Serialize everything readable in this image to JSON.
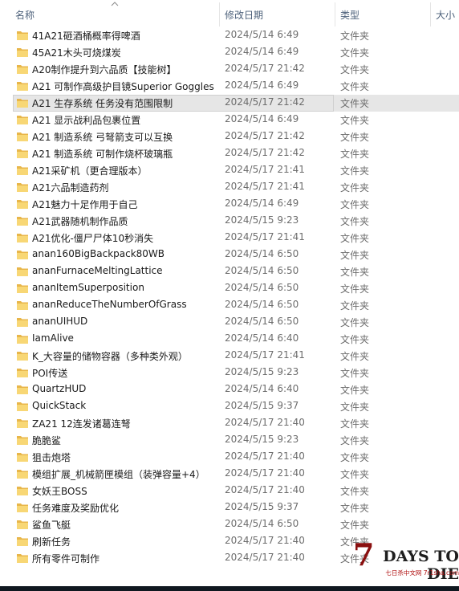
{
  "header": {
    "col_name": "名称",
    "col_date": "修改日期",
    "col_type": "类型",
    "col_size": "大小",
    "sort_icon": "chevron-up-icon"
  },
  "files": [
    {
      "name": "41A21砸酒桶概率得啤酒",
      "date": "2024/5/14 6:49",
      "type": "文件夹"
    },
    {
      "name": "45A21木头可烧煤炭",
      "date": "2024/5/14 6:49",
      "type": "文件夹"
    },
    {
      "name": "A20制作提升到六品质【技能树】",
      "date": "2024/5/17 21:42",
      "type": "文件夹"
    },
    {
      "name": "A21 可制作高级护目镜Superior Goggles",
      "date": "2024/5/14 6:49",
      "type": "文件夹"
    },
    {
      "name": "A21 生存系统 任务没有范围限制",
      "date": "2024/5/17 21:42",
      "type": "文件夹",
      "selected": true
    },
    {
      "name": "A21 显示战利品包裹位置",
      "date": "2024/5/14 6:49",
      "type": "文件夹"
    },
    {
      "name": "A21 制造系统 弓弩箭支可以互换",
      "date": "2024/5/17 21:42",
      "type": "文件夹"
    },
    {
      "name": "A21 制造系统 可制作烧杯玻璃瓶",
      "date": "2024/5/17 21:42",
      "type": "文件夹"
    },
    {
      "name": "A21采矿机（更合理版本）",
      "date": "2024/5/17 21:41",
      "type": "文件夹"
    },
    {
      "name": "A21六品制造药剂",
      "date": "2024/5/17 21:41",
      "type": "文件夹"
    },
    {
      "name": "A21魅力十足作用于自己",
      "date": "2024/5/14 6:49",
      "type": "文件夹"
    },
    {
      "name": "A21武器随机制作品质",
      "date": "2024/5/15 9:23",
      "type": "文件夹"
    },
    {
      "name": "A21优化-僵尸尸体10秒消失",
      "date": "2024/5/17 21:41",
      "type": "文件夹"
    },
    {
      "name": "anan160BigBackpack80WB",
      "date": "2024/5/14 6:50",
      "type": "文件夹"
    },
    {
      "name": "ananFurnaceMeltingLattice",
      "date": "2024/5/14 6:50",
      "type": "文件夹"
    },
    {
      "name": "ananItemSuperposition",
      "date": "2024/5/14 6:50",
      "type": "文件夹"
    },
    {
      "name": "ananReduceTheNumberOfGrass",
      "date": "2024/5/14 6:50",
      "type": "文件夹"
    },
    {
      "name": "ananUIHUD",
      "date": "2024/5/14 6:50",
      "type": "文件夹"
    },
    {
      "name": "IamAlive",
      "date": "2024/5/14 6:40",
      "type": "文件夹"
    },
    {
      "name": "K_大容量的储物容器（多种类外观）",
      "date": "2024/5/17 21:41",
      "type": "文件夹"
    },
    {
      "name": "POI传送",
      "date": "2024/5/15 9:23",
      "type": "文件夹"
    },
    {
      "name": "QuartzHUD",
      "date": "2024/5/14 6:40",
      "type": "文件夹"
    },
    {
      "name": "QuickStack",
      "date": "2024/5/15 9:37",
      "type": "文件夹"
    },
    {
      "name": "ZA21 12连发诸葛连弩",
      "date": "2024/5/17 21:40",
      "type": "文件夹"
    },
    {
      "name": "脆脆鲨",
      "date": "2024/5/15 9:23",
      "type": "文件夹"
    },
    {
      "name": "狙击炮塔",
      "date": "2024/5/17 21:40",
      "type": "文件夹"
    },
    {
      "name": "模组扩展_机械箭匣模组（装弹容量+4）",
      "date": "2024/5/17 21:40",
      "type": "文件夹"
    },
    {
      "name": "女妖王BOSS",
      "date": "2024/5/17 21:40",
      "type": "文件夹"
    },
    {
      "name": "任务难度及奖励优化",
      "date": "2024/5/15 9:37",
      "type": "文件夹"
    },
    {
      "name": "鲨鱼飞艇",
      "date": "2024/5/14 6:50",
      "type": "文件夹"
    },
    {
      "name": "刷新任务",
      "date": "2024/5/17 21:40",
      "type": "文件夹"
    },
    {
      "name": "所有零件可制作",
      "date": "2024/5/17 21:40",
      "type": "文件夹"
    }
  ],
  "colors": {
    "folder_fill": "#f8d775",
    "folder_dark": "#e8b64a",
    "header_text": "#4c607a",
    "selected_bg": "#e6e6e6"
  },
  "watermark": {
    "seven": "7",
    "title": "DAYS TO DIE",
    "subtitle": "七日杀中文网 7r1sha.com"
  }
}
